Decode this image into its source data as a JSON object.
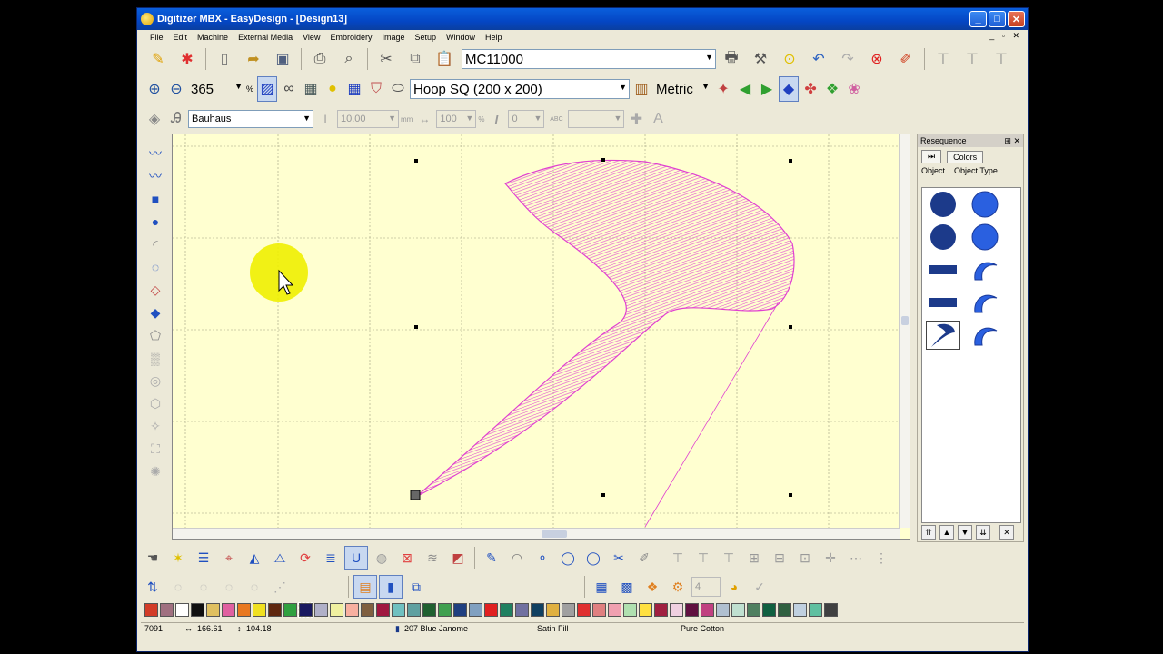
{
  "window": {
    "title": "Digitizer MBX - EasyDesign - [Design13]",
    "controls": [
      "_",
      "□",
      "✕"
    ]
  },
  "menu": {
    "items": [
      "File",
      "Edit",
      "Machine",
      "External Media",
      "View",
      "Embroidery",
      "Image",
      "Setup",
      "Window",
      "Help"
    ],
    "mdi_controls": "_ ▫ ✕"
  },
  "toolbar1": {
    "machine_value": "MC11000"
  },
  "toolbar2": {
    "zoom_value": "365",
    "zoom_unit": "%",
    "hoop_value": "Hoop SQ (200 x 200)",
    "units_value": "Metric"
  },
  "toolbar3": {
    "font_value": "Bauhaus",
    "size_value": "10.00",
    "size_unit": "mm",
    "width_value": "100",
    "width_unit": "%",
    "italic_label": "I",
    "angle_value": "0",
    "spacing_label": "ABC",
    "style_value": ""
  },
  "resequence": {
    "title": "Resequence",
    "controls": "⊞ ✕",
    "colors_button": "Colors",
    "tab_object": "Object",
    "tab_object_type": "Object Type",
    "rows": [
      {
        "object": "circle",
        "type": "circle"
      },
      {
        "object": "circle",
        "type": "circle"
      },
      {
        "object": "bar",
        "type": "crescent"
      },
      {
        "object": "bar",
        "type": "crescent"
      },
      {
        "object": "boomerang",
        "type": "crescent"
      }
    ]
  },
  "palette": {
    "colors": [
      "#d23c28",
      "#a07080",
      "#ffffff",
      "#101010",
      "#e0c060",
      "#e060a0",
      "#e87820",
      "#f0e020",
      "#602810",
      "#30a040",
      "#1a1a60",
      "#b0b0c8",
      "#f0f0a0",
      "#f8b0a0",
      "#806040",
      "#a01840",
      "#70c0c0",
      "#60a0a0",
      "#206030",
      "#40a050",
      "#204080",
      "#80a0c0",
      "#e02020",
      "#208060",
      "#7070a0",
      "#104060",
      "#e0b040",
      "#a0a0a0",
      "#e03030",
      "#e08080",
      "#f0a0b0",
      "#b0e0b0",
      "#ffe040",
      "#a02040",
      "#f0d0e0",
      "#601040",
      "#c04080",
      "#b0c0d0",
      "#c0e0d0",
      "#508060",
      "#106040",
      "#306040",
      "#c0d0e0",
      "#60c0a0",
      "#404040"
    ]
  },
  "status": {
    "stitch_count": "7091",
    "width": "166.61",
    "height": "104.18",
    "thread": "207 Blue Janome",
    "fill_type": "Satin Fill",
    "fabric": "Pure Cotton"
  },
  "colors": {
    "canvas_bg": "#ffffd0",
    "stitch_color": "#e040d0",
    "accent_blue": "#2060e0"
  }
}
